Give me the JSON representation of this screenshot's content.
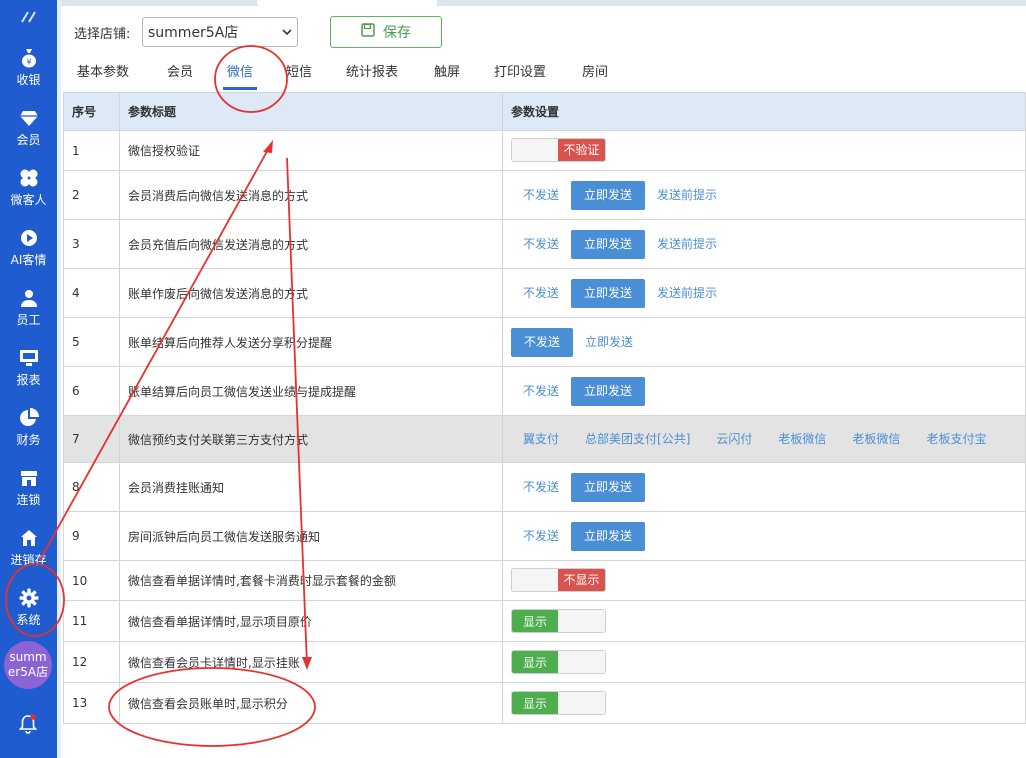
{
  "sidebar": {
    "items": [
      {
        "label": "收银",
        "icon": "money-bag-icon"
      },
      {
        "label": "会员",
        "icon": "diamond-icon"
      },
      {
        "label": "微客人",
        "icon": "clover-icon"
      },
      {
        "label": "AI客情",
        "icon": "play-circle-icon"
      },
      {
        "label": "员工",
        "icon": "person-icon"
      },
      {
        "label": "报表",
        "icon": "monitor-icon"
      },
      {
        "label": "财务",
        "icon": "pie-chart-icon"
      },
      {
        "label": "连锁",
        "icon": "store-icon"
      },
      {
        "label": "进销存",
        "icon": "house-icon"
      },
      {
        "label": "系统",
        "icon": "gear-icon"
      }
    ],
    "store_badge": "summer5A店"
  },
  "toolbar": {
    "store_label": "选择店铺:",
    "store_value": "summer5A店",
    "save_label": "保存"
  },
  "tabs": [
    {
      "label": "基本参数"
    },
    {
      "label": "会员"
    },
    {
      "label": "微信"
    },
    {
      "label": "短信"
    },
    {
      "label": "统计报表"
    },
    {
      "label": "触屏"
    },
    {
      "label": "打印设置"
    },
    {
      "label": "房间"
    }
  ],
  "active_tab": "微信",
  "table": {
    "headers": [
      "序号",
      "参数标题",
      "参数设置"
    ],
    "rows": [
      {
        "no": "1",
        "title": "微信授权验证",
        "toggle": {
          "state": "off",
          "label": "不验证"
        }
      },
      {
        "no": "2",
        "title": "会员消费后向微信发送消息的方式",
        "options": [
          "不发送",
          "立即发送",
          "发送前提示"
        ],
        "selected": 1
      },
      {
        "no": "3",
        "title": "会员充值后向微信发送消息的方式",
        "options": [
          "不发送",
          "立即发送",
          "发送前提示"
        ],
        "selected": 1
      },
      {
        "no": "4",
        "title": "账单作废后向微信发送消息的方式",
        "options": [
          "不发送",
          "立即发送",
          "发送前提示"
        ],
        "selected": 1
      },
      {
        "no": "5",
        "title": "账单结算后向推荐人发送分享积分提醒",
        "options": [
          "不发送",
          "立即发送"
        ],
        "selected": 0
      },
      {
        "no": "6",
        "title": "账单结算后向员工微信发送业绩与提成提醒",
        "options": [
          "不发送",
          "立即发送"
        ],
        "selected": 1
      },
      {
        "no": "7",
        "title": "微信预约支付关联第三方支付方式",
        "options": [
          "翼支付",
          "总部美团支付[公共]",
          "云闪付",
          "老板微信",
          "老板微信",
          "老板支付宝"
        ],
        "selected": -1
      },
      {
        "no": "8",
        "title": "会员消费挂账通知",
        "options": [
          "不发送",
          "立即发送"
        ],
        "selected": 1
      },
      {
        "no": "9",
        "title": "房间派钟后向员工微信发送服务通知",
        "options": [
          "不发送",
          "立即发送"
        ],
        "selected": 1
      },
      {
        "no": "10",
        "title": "微信查看单据详情时,套餐卡消费时显示套餐的金额",
        "toggle": {
          "state": "off",
          "label": "不显示"
        }
      },
      {
        "no": "11",
        "title": "微信查看单据详情时,显示项目原价",
        "toggle": {
          "state": "on",
          "label": "显示"
        }
      },
      {
        "no": "12",
        "title": "微信查看会员卡详情时,显示挂账",
        "toggle": {
          "state": "on",
          "label": "显示"
        }
      },
      {
        "no": "13",
        "title": "微信查看会员账单时,显示积分",
        "toggle": {
          "state": "on",
          "label": "显示"
        }
      }
    ]
  },
  "colors": {
    "sidebar": "#1f5ccf",
    "accent": "#4a8fd6",
    "toggle_on": "#4cae4c",
    "toggle_off": "#d9534f",
    "annotation": "#e8312d"
  }
}
